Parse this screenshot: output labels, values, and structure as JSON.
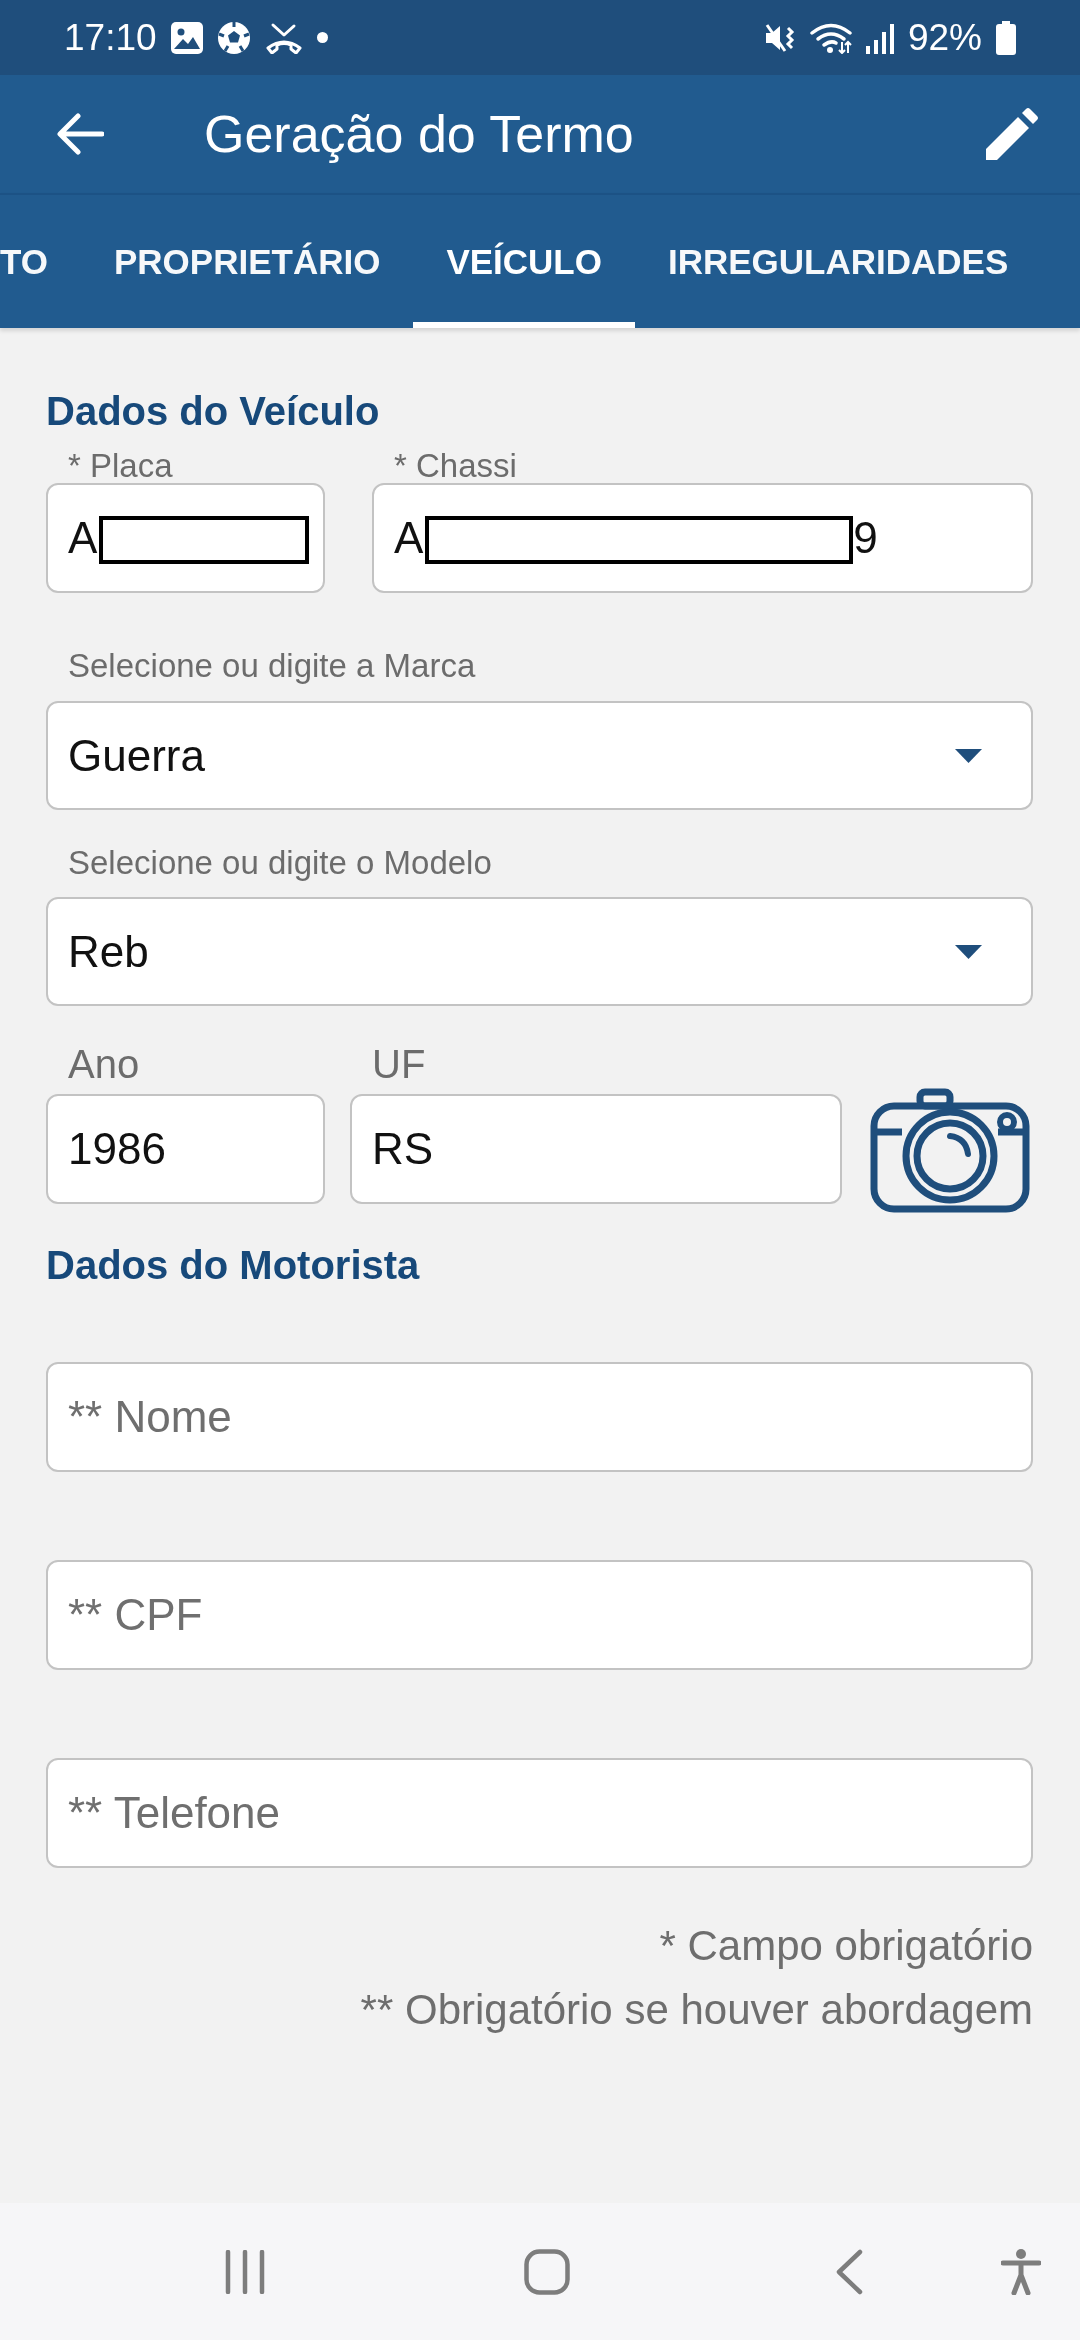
{
  "status_bar": {
    "time": "17:10",
    "battery": "92%"
  },
  "app_bar": {
    "title": "Geração do Termo"
  },
  "tabs": [
    {
      "label": "TO",
      "selected": false
    },
    {
      "label": "PROPRIETÁRIO",
      "selected": false
    },
    {
      "label": "VEÍCULO",
      "selected": true
    },
    {
      "label": "IRREGULARIDADES",
      "selected": false
    }
  ],
  "vehicle_section": {
    "heading": "Dados do Veículo",
    "plate": {
      "label": "* Placa",
      "value_start": "A",
      "redacted": true
    },
    "chassis": {
      "label": "* Chassi",
      "value_start": "A",
      "redacted": true,
      "value_end": "9"
    },
    "brand": {
      "label": "Selecione ou digite a Marca",
      "value": "Guerra"
    },
    "model": {
      "label": "Selecione ou digite o Modelo",
      "value": "Reb"
    },
    "year": {
      "label": "Ano",
      "value": "1986"
    },
    "state": {
      "label": "UF",
      "value": "RS"
    }
  },
  "driver_section": {
    "heading": "Dados do Motorista",
    "fields": [
      {
        "placeholder": "** Nome"
      },
      {
        "placeholder": "** CPF"
      },
      {
        "placeholder": "** Telefone"
      }
    ]
  },
  "notes": [
    "* Campo obrigatório",
    "** Obrigatório se houver abordagem"
  ]
}
